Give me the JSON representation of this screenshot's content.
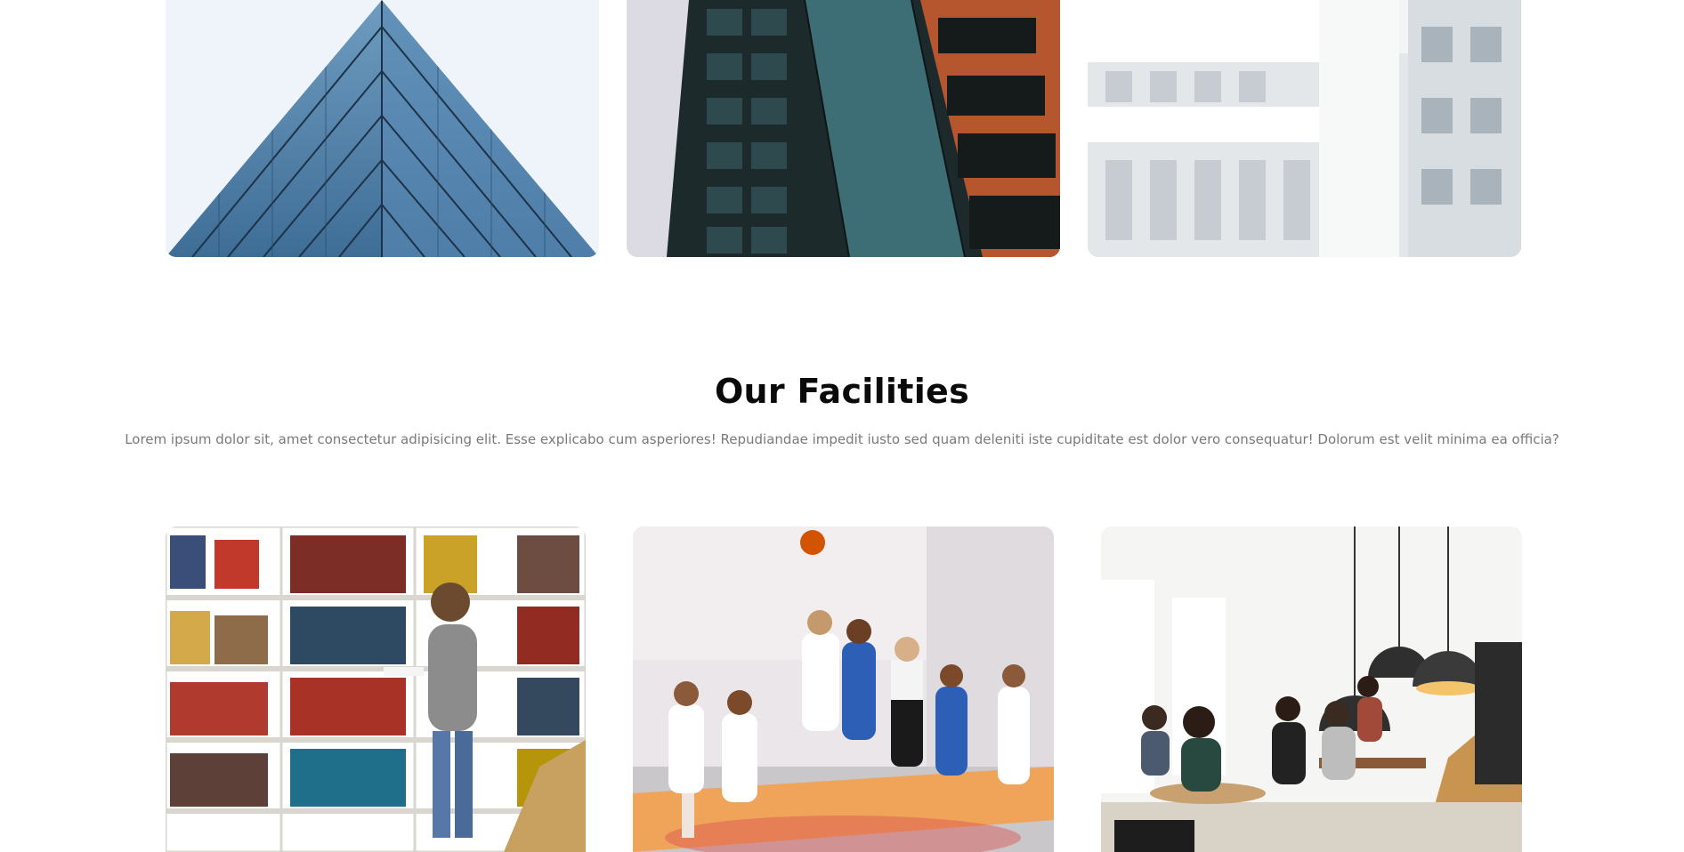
{
  "gallery": {
    "images": [
      {
        "name": "glass-tower"
      },
      {
        "name": "dark-orange-tower"
      },
      {
        "name": "white-apartments"
      }
    ]
  },
  "facilities": {
    "title": "Our Facilities",
    "description": "Lorem ipsum dolor sit, amet consectetur adipisicing elit. Esse explicabo cum asperiores! Repudiandae impedit iusto sed quam deleniti iste cupiditate est dolor vero consequatur! Dolorum est velit minima ea officia?",
    "items": [
      {
        "name": "library"
      },
      {
        "name": "basketball-court"
      },
      {
        "name": "cafeteria"
      }
    ]
  }
}
